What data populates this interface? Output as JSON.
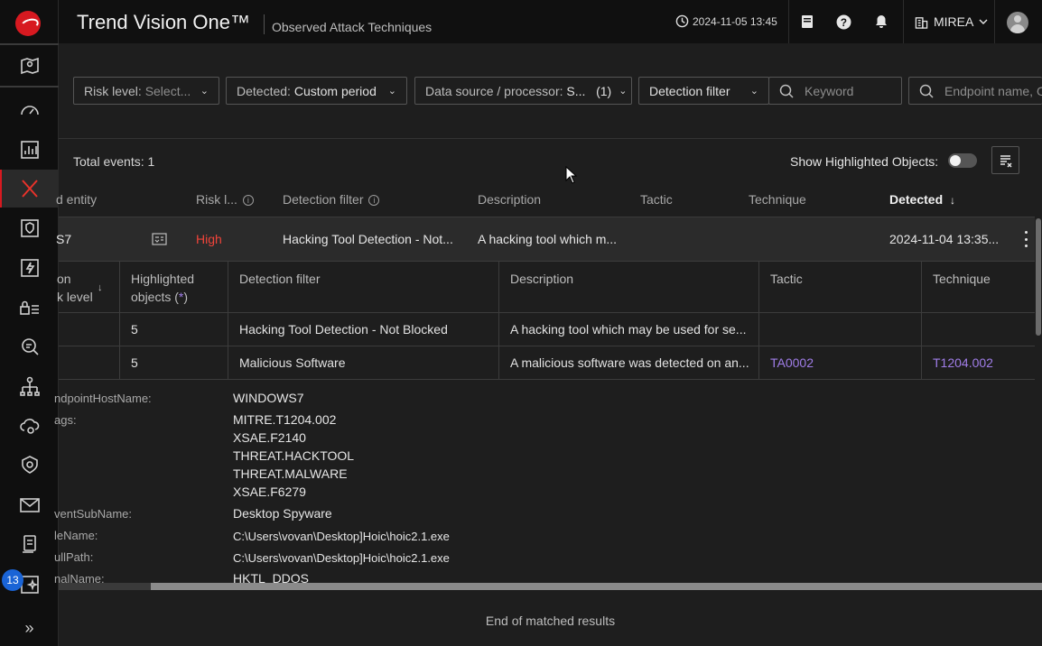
{
  "app": {
    "title": "Trend Vision One™",
    "page_title": "Observed Attack Techniques",
    "datetime": "2024-11-05 13:45",
    "org": "MIREA",
    "notification_badge": "13",
    "brand_color": "#d71920",
    "accent_color": "#a07de8"
  },
  "sidebar": {
    "items": [
      {
        "icon": "map-icon"
      },
      {
        "icon": "gauge-icon"
      },
      {
        "icon": "chart-icon"
      },
      {
        "icon": "xdr-icon",
        "active": true
      },
      {
        "icon": "hand-shield-icon"
      },
      {
        "icon": "bolt-icon"
      },
      {
        "icon": "lock-list-icon"
      },
      {
        "icon": "search-doc-icon"
      },
      {
        "icon": "network-icon"
      },
      {
        "icon": "cloud-gear-icon"
      },
      {
        "icon": "eye-shield-icon"
      },
      {
        "icon": "mail-icon"
      },
      {
        "icon": "device-icon"
      },
      {
        "icon": "sparkle-icon"
      },
      {
        "icon": "expand-icon"
      }
    ],
    "expand_glyph": "»"
  },
  "filters": {
    "risk_label": "Risk level:",
    "risk_placeholder": "Select...",
    "detected_label": "Detected:",
    "detected_value": "Custom period",
    "source_label": "Data source / processor:",
    "source_value": "S...",
    "source_count": "(1)",
    "detection_filter": "Detection filter",
    "keyword_placeholder": "Keyword",
    "endpoint_placeholder": "Endpoint name, O"
  },
  "results": {
    "total_label": "Total events:",
    "total_count": "1",
    "show_highlighted": "Show Highlighted Objects:",
    "end_text": "End of matched results"
  },
  "table": {
    "headers": {
      "entity": "d entity",
      "risk": "Risk l...",
      "detection_filter": "Detection filter",
      "description": "Description",
      "tactic": "Tactic",
      "technique": "Technique",
      "detected": "Detected"
    },
    "row": {
      "entity": "S7",
      "risk": "High",
      "detection_filter": "Hacking Tool Detection - Not...",
      "description": "A hacking tool which m...",
      "detected": "2024-11-04 13:35..."
    }
  },
  "subtable": {
    "headers": {
      "risk_line1": "on",
      "risk_line2": "k level",
      "highlighted_line1": "Highlighted",
      "highlighted_line2": "objects (",
      "highlighted_star": "*",
      "highlighted_end": ")",
      "detection_filter": "Detection filter",
      "description": "Description",
      "tactic": "Tactic",
      "technique": "Technique"
    },
    "rows": [
      {
        "count": "5",
        "filter": "Hacking Tool Detection - Not Blocked",
        "description": "A hacking tool which may be used for se...",
        "tactic": "",
        "technique": ""
      },
      {
        "count": "5",
        "filter": "Malicious Software",
        "description": "A malicious software was detected on an...",
        "tactic": "TA0002",
        "technique": "T1204.002"
      }
    ]
  },
  "details": {
    "endpoint_key": "ndpointHostName:",
    "endpoint_val": "WINDOWS7",
    "tags_key": "ags:",
    "tags": [
      "MITRE.T1204.002",
      "XSAE.F2140",
      "THREAT.HACKTOOL",
      "THREAT.MALWARE",
      "XSAE.F6279"
    ],
    "subname_key": "ventSubName:",
    "subname_val": "Desktop Spyware",
    "filename_key": "leName:",
    "filename_val": "C:\\Users\\vovan\\Desktop]Hoic\\hoic2.1.exe",
    "fullpath_key": "ullPath:",
    "fullpath_val": "C:\\Users\\vovan\\Desktop]Hoic\\hoic2.1.exe",
    "malname_key": "nalName:",
    "malname_val": "HKTL_DDOS"
  }
}
